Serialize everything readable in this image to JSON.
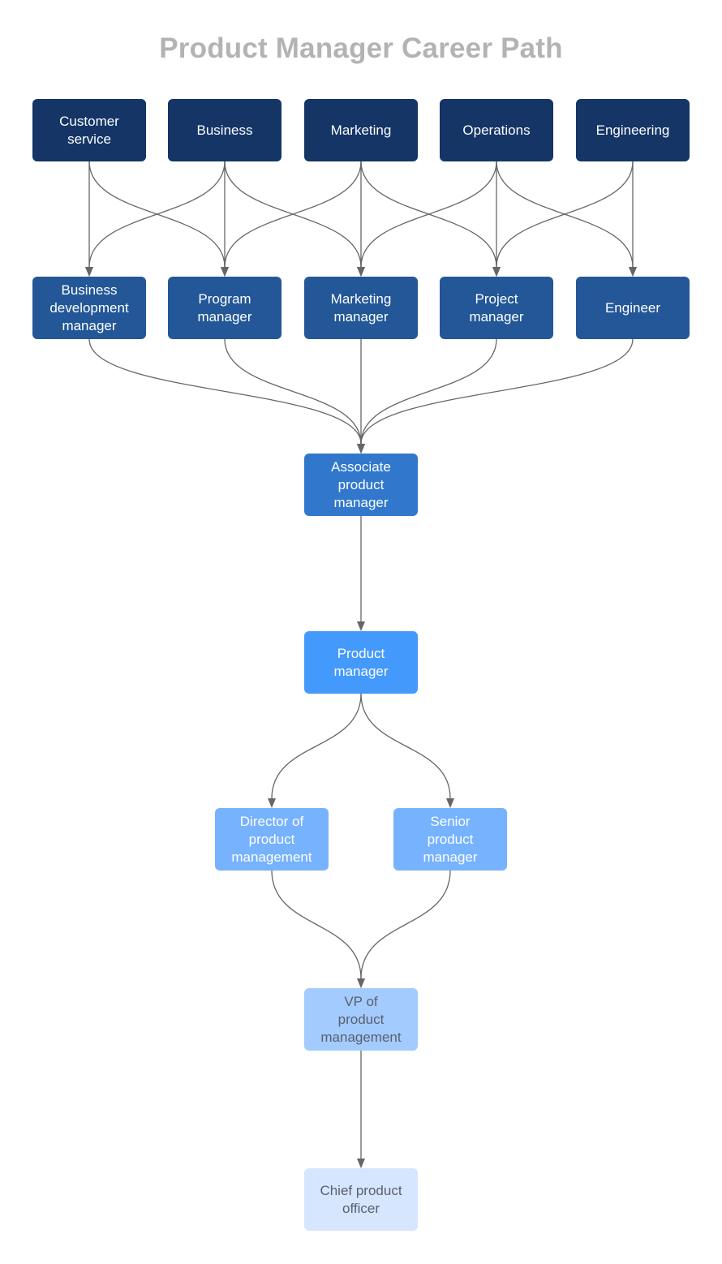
{
  "title": "Product Manager Career Path",
  "colors": {
    "edge": "#666666",
    "title": "#b3b3b3"
  },
  "nodes": [
    {
      "id": "customer-service",
      "label": "Customer\nservice",
      "level": 1
    },
    {
      "id": "business",
      "label": "Business",
      "level": 1
    },
    {
      "id": "marketing",
      "label": "Marketing",
      "level": 1
    },
    {
      "id": "operations",
      "label": "Operations",
      "level": 1
    },
    {
      "id": "engineering",
      "label": "Engineering",
      "level": 1
    },
    {
      "id": "business-development-manager",
      "label": "Business\ndevelopment\nmanager",
      "level": 2
    },
    {
      "id": "program-manager",
      "label": "Program\nmanager",
      "level": 2
    },
    {
      "id": "marketing-manager",
      "label": "Marketing\nmanager",
      "level": 2
    },
    {
      "id": "project-manager",
      "label": "Project\nmanager",
      "level": 2
    },
    {
      "id": "engineer",
      "label": "Engineer",
      "level": 2
    },
    {
      "id": "associate-product-manager",
      "label": "Associate\nproduct\nmanager",
      "level": 3
    },
    {
      "id": "product-manager",
      "label": "Product\nmanager",
      "level": 4
    },
    {
      "id": "director-of-product-management",
      "label": "Director of\nproduct\nmanagement",
      "level": 5
    },
    {
      "id": "senior-product-manager",
      "label": "Senior\nproduct\nmanager",
      "level": 5
    },
    {
      "id": "vp-of-product-management",
      "label": "VP of\nproduct\nmanagement",
      "level": 6
    },
    {
      "id": "chief-product-officer",
      "label": "Chief product\nofficer",
      "level": 7
    }
  ],
  "edges": [
    [
      "customer-service",
      "business-development-manager"
    ],
    [
      "customer-service",
      "program-manager"
    ],
    [
      "business",
      "business-development-manager"
    ],
    [
      "business",
      "program-manager"
    ],
    [
      "business",
      "marketing-manager"
    ],
    [
      "marketing",
      "program-manager"
    ],
    [
      "marketing",
      "marketing-manager"
    ],
    [
      "marketing",
      "project-manager"
    ],
    [
      "operations",
      "marketing-manager"
    ],
    [
      "operations",
      "project-manager"
    ],
    [
      "operations",
      "engineer"
    ],
    [
      "engineering",
      "project-manager"
    ],
    [
      "engineering",
      "engineer"
    ],
    [
      "business-development-manager",
      "associate-product-manager"
    ],
    [
      "program-manager",
      "associate-product-manager"
    ],
    [
      "marketing-manager",
      "associate-product-manager"
    ],
    [
      "project-manager",
      "associate-product-manager"
    ],
    [
      "engineer",
      "associate-product-manager"
    ],
    [
      "associate-product-manager",
      "product-manager"
    ],
    [
      "product-manager",
      "director-of-product-management"
    ],
    [
      "product-manager",
      "senior-product-manager"
    ],
    [
      "director-of-product-management",
      "vp-of-product-management"
    ],
    [
      "senior-product-manager",
      "vp-of-product-management"
    ],
    [
      "vp-of-product-management",
      "chief-product-officer"
    ]
  ]
}
